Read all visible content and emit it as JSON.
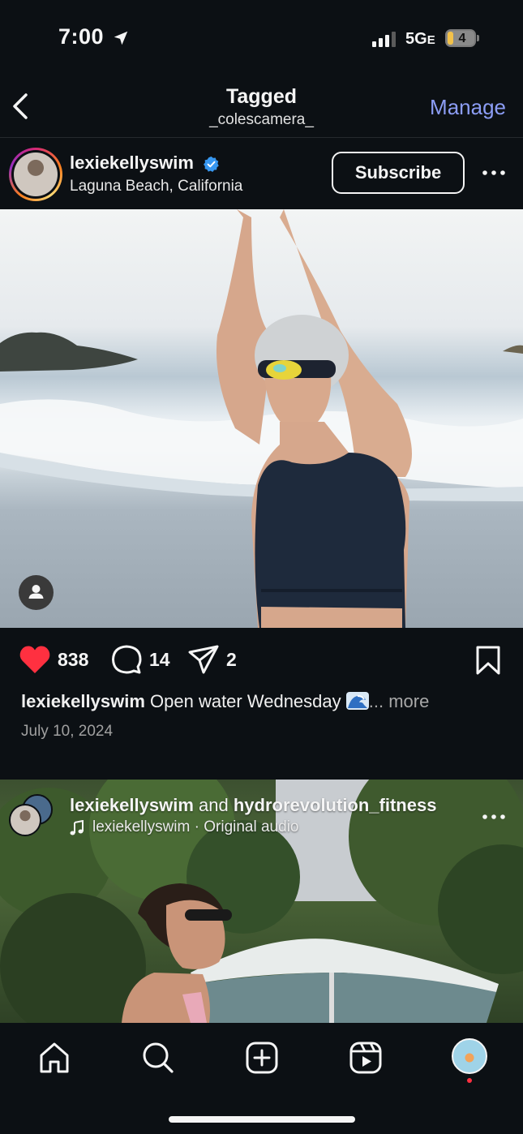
{
  "status_bar": {
    "time": "7:00",
    "network": "5G",
    "network_suffix": "E",
    "battery": "4"
  },
  "header": {
    "title": "Tagged",
    "subtitle": "_colescamera_",
    "manage_label": "Manage"
  },
  "post": {
    "username": "lexiekellyswim",
    "verified": true,
    "location": "Laguna Beach, California",
    "subscribe_label": "Subscribe",
    "likes": "838",
    "comments": "14",
    "shares": "2",
    "caption_user": "lexiekellyswim",
    "caption_text": "Open water Wednesday",
    "caption_more": "... more",
    "date": "July 10, 2024"
  },
  "reel": {
    "user1": "lexiekellyswim",
    "conjunction": "and",
    "user2": "hydrorevolution_fitness",
    "audio": "lexiekellyswim · Original audio"
  },
  "tabs": [
    "home",
    "search",
    "create",
    "reels",
    "profile"
  ],
  "colors": {
    "accent": "#8c9df5",
    "like": "#ff3040",
    "verified": "#3797f0",
    "background": "#0c1014"
  }
}
